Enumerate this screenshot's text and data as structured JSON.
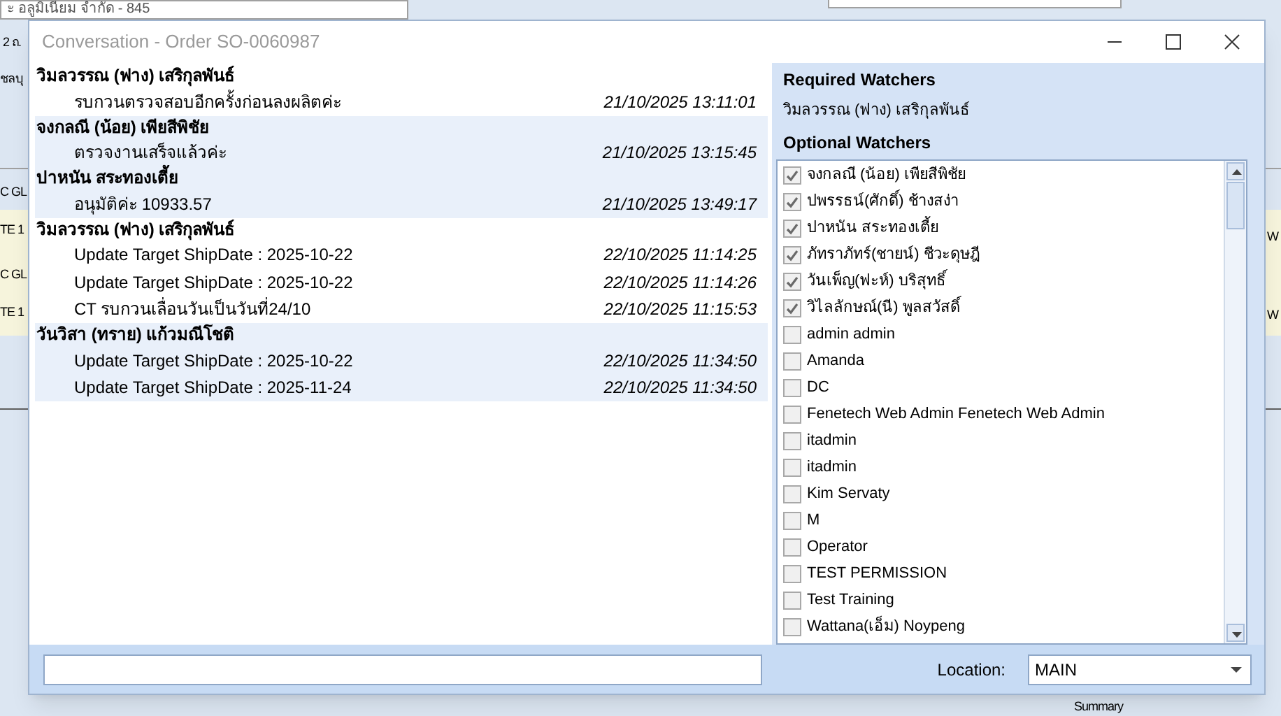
{
  "background": {
    "dropdown_text": "ะ อลูมิเนียม จำกัด - 845",
    "fragments": [
      "2 ถ.",
      "ชลบุ",
      "C GL",
      "TE 1",
      "C GL",
      "TE 1",
      "W",
      "W",
      "Summary"
    ]
  },
  "window": {
    "title": "Conversation - Order SO-0060987"
  },
  "conversation": [
    {
      "author": "วิมลวรรณ (ฟาง) เสริกุลพันธ์",
      "shaded": false,
      "messages": [
        {
          "text": "รบกวนตรวจสอบอีกครั้งก่อนลงผลิตค่ะ",
          "time": "21/10/2025 13:11:01"
        }
      ]
    },
    {
      "author": "จงกลณี (น้อย) เพียสีพิชัย",
      "shaded": true,
      "messages": [
        {
          "text": "ตรวจงานเสร็จแล้วค่ะ",
          "time": "21/10/2025 13:15:45"
        }
      ]
    },
    {
      "author": "ปาหนัน สระทองเตี้ย",
      "shaded": true,
      "messages": [
        {
          "text": "อนุมัติค่ะ 10933.57",
          "time": "21/10/2025 13:49:17"
        }
      ]
    },
    {
      "author": "วิมลวรรณ (ฟาง) เสริกุลพันธ์",
      "shaded": false,
      "messages": [
        {
          "text": "Update Target ShipDate : 2025-10-22",
          "time": "22/10/2025 11:14:25"
        },
        {
          "text": "Update Target ShipDate : 2025-10-22",
          "time": "22/10/2025 11:14:26"
        },
        {
          "text": "CT รบกวนเลื่อนวันเป็นวันที่24/10",
          "time": "22/10/2025 11:15:53"
        }
      ]
    },
    {
      "author": "วันวิสา (ทราย) แก้วมณีโชติ",
      "shaded": true,
      "messages": [
        {
          "text": "Update Target ShipDate : 2025-10-22",
          "time": "22/10/2025 11:34:50"
        },
        {
          "text": "Update Target ShipDate : 2025-11-24",
          "time": "22/10/2025 11:34:50"
        }
      ]
    }
  ],
  "required_watchers": {
    "title": "Required Watchers",
    "names": [
      "วิมลวรรณ (ฟาง) เสริกุลพันธ์"
    ]
  },
  "optional_watchers": {
    "title": "Optional Watchers",
    "items": [
      {
        "name": "จงกลณี (น้อย) เพียสีพิชัย",
        "checked": true
      },
      {
        "name": "ปพรรธน์(ศักดิ์) ช้างสง่า",
        "checked": true
      },
      {
        "name": "ปาหนัน สระทองเตี้ย",
        "checked": true
      },
      {
        "name": "ภัทราภัทร์(ชายน์) ชีวะดุษฎี",
        "checked": true
      },
      {
        "name": "วันเพ็ญ(ฟะห์) บริสุทธิ์",
        "checked": true
      },
      {
        "name": "วิไลลักษณ์(นี) พูลสวัสดิ์",
        "checked": true
      },
      {
        "name": "admin admin",
        "checked": false
      },
      {
        "name": "Amanda",
        "checked": false
      },
      {
        "name": "DC",
        "checked": false
      },
      {
        "name": "Fenetech Web Admin Fenetech Web Admin",
        "checked": false
      },
      {
        "name": "itadmin",
        "checked": false
      },
      {
        "name": "itadmin",
        "checked": false
      },
      {
        "name": "Kim Servaty",
        "checked": false
      },
      {
        "name": "M",
        "checked": false
      },
      {
        "name": "Operator",
        "checked": false
      },
      {
        "name": "TEST PERMISSION",
        "checked": false
      },
      {
        "name": "Test Training",
        "checked": false
      },
      {
        "name": "Wattana(เอ็ม) Noypeng",
        "checked": false
      }
    ]
  },
  "footer": {
    "location_label": "Location:",
    "location_value": "MAIN"
  }
}
